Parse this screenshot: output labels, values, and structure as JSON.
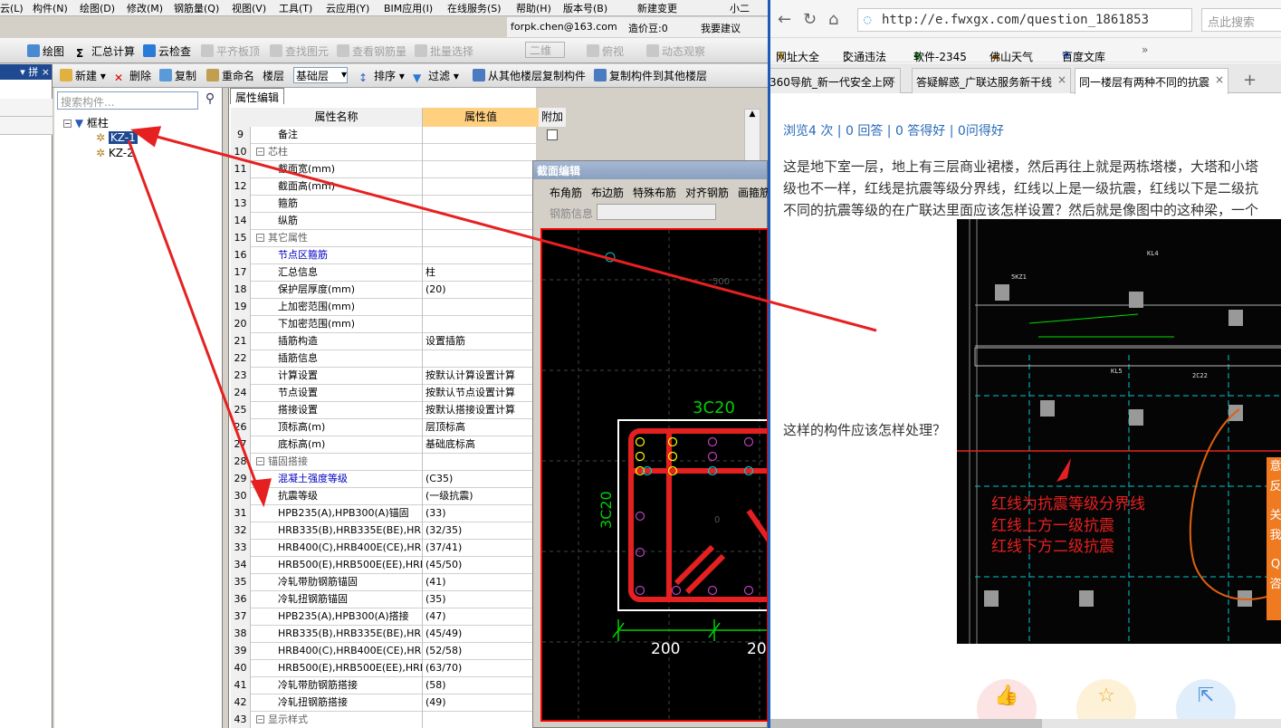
{
  "app": {
    "menu": [
      "云(L)",
      "构件(N)",
      "绘图(D)",
      "修改(M)",
      "钢筋量(Q)",
      "视图(V)",
      "工具(T)",
      "云应用(Y)",
      "BIM应用(I)",
      "在线服务(S)",
      "帮助(H)",
      "版本号(B)",
      "新建变更",
      "小二"
    ],
    "status": {
      "account": "forpk.chen@163.com",
      "beans": "造价豆:0",
      "feedback": "我要建议"
    },
    "toolbar1": [
      "绘图",
      "汇总计算",
      "云检查",
      "平齐板顶",
      "查找图元",
      "查看钢筋量",
      "批量选择",
      "二维",
      "俯视",
      "动态观察"
    ],
    "toolbar2": [
      "新建",
      "删除",
      "复制",
      "重命名",
      "楼层",
      "基础层",
      "排序",
      "过滤",
      "从其他楼层复制构件",
      "复制构件到其他楼层"
    ],
    "nav_pin": "▾ 拼 ×",
    "search_placeholder": "搜索构件...",
    "tree": {
      "root": "框柱",
      "items": [
        "KZ-1",
        "KZ-2"
      ]
    },
    "property_tab": "属性编辑",
    "property_headers": [
      "属性名称",
      "属性值",
      "附加"
    ],
    "properties": [
      {
        "n": "9",
        "k": "备注",
        "v": "",
        "chk": true
      },
      {
        "n": "10",
        "k": "芯柱",
        "v": "",
        "group": true
      },
      {
        "n": "11",
        "k": "截面宽(mm)",
        "v": ""
      },
      {
        "n": "12",
        "k": "截面高(mm)",
        "v": ""
      },
      {
        "n": "13",
        "k": "箍筋",
        "v": ""
      },
      {
        "n": "14",
        "k": "纵筋",
        "v": ""
      },
      {
        "n": "15",
        "k": "其它属性",
        "v": "",
        "group": true
      },
      {
        "n": "16",
        "k": "节点区箍筋",
        "v": "",
        "blue": true
      },
      {
        "n": "17",
        "k": "汇总信息",
        "v": "柱"
      },
      {
        "n": "18",
        "k": "保护层厚度(mm)",
        "v": "(20)"
      },
      {
        "n": "19",
        "k": "上加密范围(mm)",
        "v": ""
      },
      {
        "n": "20",
        "k": "下加密范围(mm)",
        "v": ""
      },
      {
        "n": "21",
        "k": "插筋构造",
        "v": "设置插筋"
      },
      {
        "n": "22",
        "k": "插筋信息",
        "v": ""
      },
      {
        "n": "23",
        "k": "计算设置",
        "v": "按默认计算设置计算"
      },
      {
        "n": "24",
        "k": "节点设置",
        "v": "按默认节点设置计算"
      },
      {
        "n": "25",
        "k": "搭接设置",
        "v": "按默认搭接设置计算"
      },
      {
        "n": "26",
        "k": "顶标高(m)",
        "v": "层顶标高"
      },
      {
        "n": "27",
        "k": "底标高(m)",
        "v": "基础底标高"
      },
      {
        "n": "28",
        "k": "锚固搭接",
        "v": "",
        "group": true
      },
      {
        "n": "29",
        "k": "混凝土强度等级",
        "v": "(C35)",
        "blue": true
      },
      {
        "n": "30",
        "k": "抗震等级",
        "v": "(一级抗震)"
      },
      {
        "n": "31",
        "k": "HPB235(A),HPB300(A)锚固",
        "v": "(33)"
      },
      {
        "n": "32",
        "k": "HRB335(B),HRB335E(BE),HRBF",
        "v": "(32/35)"
      },
      {
        "n": "33",
        "k": "HRB400(C),HRB400E(CE),HRBF",
        "v": "(37/41)"
      },
      {
        "n": "34",
        "k": "HRB500(E),HRB500E(EE),HRBF",
        "v": "(45/50)"
      },
      {
        "n": "35",
        "k": "冷轧带肋钢筋锚固",
        "v": "(41)"
      },
      {
        "n": "36",
        "k": "冷轧扭钢筋锚固",
        "v": "(35)"
      },
      {
        "n": "37",
        "k": "HPB235(A),HPB300(A)搭接",
        "v": "(47)"
      },
      {
        "n": "38",
        "k": "HRB335(B),HRB335E(BE),HRBF",
        "v": "(45/49)"
      },
      {
        "n": "39",
        "k": "HRB400(C),HRB400E(CE),HRBF",
        "v": "(52/58)"
      },
      {
        "n": "40",
        "k": "HRB500(E),HRB500E(EE),HRBF",
        "v": "(63/70)"
      },
      {
        "n": "41",
        "k": "冷轧带肋钢筋搭接",
        "v": "(58)"
      },
      {
        "n": "42",
        "k": "冷轧扭钢筋搭接",
        "v": "(49)"
      },
      {
        "n": "43",
        "k": "显示样式",
        "v": "",
        "group": true
      }
    ],
    "section_editor": {
      "title": "截面编辑",
      "tools": [
        "布角筋",
        "布边筋",
        "特殊布筋",
        "对齐钢筋",
        "画箍筋"
      ],
      "rebar_info": "钢筋信息",
      "labels": {
        "top": "3C20",
        "left": "3C20",
        "dim1": "200",
        "dim2": "20",
        "grid": "500"
      }
    }
  },
  "browser": {
    "url": "http://e.fwxgx.com/question_1861853",
    "search_placeholder": "点此搜索",
    "bookmarks": [
      "网址大全",
      "交通违法",
      "软件-2345",
      "佛山天气",
      "百度文库"
    ],
    "tabs": [
      "360导航_新一代安全上网",
      "答疑解惑_广联达服务新干线",
      "同一楼层有两种不同的抗震"
    ],
    "stats": "浏览4 次 | 0 回答 | 0 答得好 | 0问得好",
    "question_lines": [
      "这是地下室一层，地上有三层商业裙楼，然后再往上就是两栋塔楼，大塔和小塔",
      "级也不一样，红线是抗震等级分界线，红线以上是一级抗震，红线以下是二级抗",
      "不同的抗震等级的在广联达里面应该怎样设置？然后就是像图中的这种梁，一个"
    ],
    "question_followup": "这样的构件应该怎样处理？",
    "image_annotation": [
      "红线为抗震等级分界线",
      "红线上方一级抗震",
      "红线下方二级抗震"
    ],
    "side_tabs": [
      "意",
      "反",
      "关",
      "我",
      "Q",
      "咨"
    ]
  },
  "colors": {
    "annotation_red": "#e62020",
    "cad_green": "#00d000",
    "cad_cyan": "#00c8d0"
  }
}
